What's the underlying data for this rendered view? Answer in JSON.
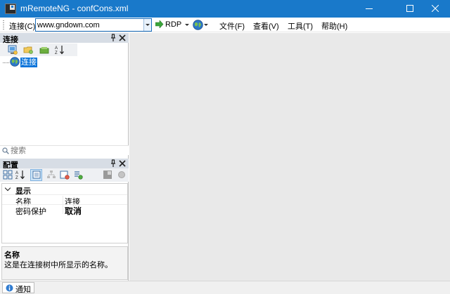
{
  "window": {
    "title": "mRemoteNG - confCons.xml",
    "minimize_label": "",
    "maximize_label": "",
    "close_label": ""
  },
  "toolbar": {
    "connect_label": "连接(C)",
    "address_value": "www.gndown.com",
    "protocol_label": "RDP"
  },
  "menu": {
    "file": "文件(F)",
    "view": "查看(V)",
    "tools": "工具(T)",
    "help": "帮助(H)"
  },
  "connections_panel": {
    "title": "连接",
    "tree_root_label": "连接",
    "search_placeholder": "搜索"
  },
  "config_panel": {
    "title": "配置",
    "category": "显示",
    "properties": [
      {
        "name": "名称",
        "value": "连接",
        "bold": false
      },
      {
        "name": "密码保护",
        "value": "取消",
        "bold": true
      }
    ],
    "description_title": "名称",
    "description_text": "这是在连接树中所显示的名称。"
  },
  "statusbar": {
    "notify_label": "通知"
  },
  "colors": {
    "titlebar": "#1979ca",
    "selection": "#0a74da",
    "panel_header": "#d7dde5",
    "workspace": "#e9e9e9"
  },
  "icons": {
    "app": "mremoteng-app-icon",
    "rdp": "green-arrow-icon",
    "globe": "globe-icon",
    "search": "search-icon",
    "notify": "info-icon"
  }
}
